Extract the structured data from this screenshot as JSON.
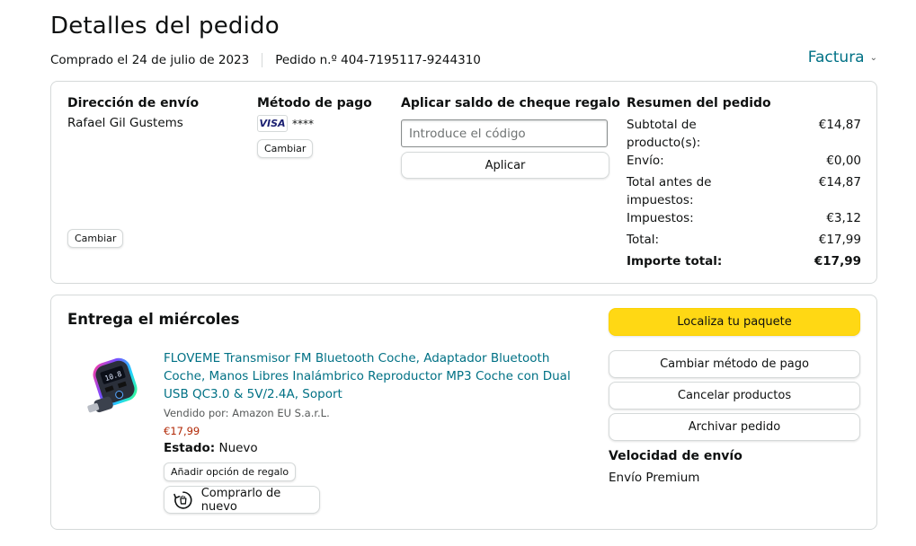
{
  "page": {
    "title": "Detalles del pedido",
    "purchase_date": "Comprado el 24 de julio de 2023",
    "order_number": "Pedido n.º 404-7195117-9244310",
    "invoice_label": "Factura"
  },
  "shipping": {
    "heading": "Dirección de envío",
    "name": "Rafael Gil Gustems",
    "change_label": "Cambiar"
  },
  "payment": {
    "heading": "Método de pago",
    "card_brand": "VISA",
    "card_mask": "****",
    "change_label": "Cambiar"
  },
  "gift_card": {
    "heading": "Aplicar saldo de cheque regalo",
    "placeholder": "Introduce el código",
    "apply_label": "Aplicar"
  },
  "summary": {
    "heading": "Resumen del pedido",
    "rows": [
      {
        "label": "Subtotal de producto(s):",
        "value": "€14,87"
      },
      {
        "label": "Envío:",
        "value": "€0,00"
      },
      {
        "label": "Total antes de impuestos:",
        "value": "€14,87"
      },
      {
        "label": "Impuestos:",
        "value": "€3,12"
      },
      {
        "label": "Total:",
        "value": "€17,99"
      }
    ],
    "grand_total_label": "Importe total:",
    "grand_total_value": "€17,99"
  },
  "delivery": {
    "heading": "Entrega el miércoles",
    "product": {
      "title": "FLOVEME Transmisor FM Bluetooth Coche, Adaptador Bluetooth Coche, Manos Libres Inalámbrico Reproductor MP3 Coche con Dual USB QC3.0 & 5V/2.4A, Soport",
      "seller": "Vendido por: Amazon EU S.a.r.L.",
      "price": "€17,99",
      "status_label": "Estado:",
      "status_value": "Nuevo",
      "gift_label": "Añadir opción de regalo",
      "rebuy_label": "Comprarlo de nuevo"
    },
    "actions": {
      "track": "Localiza tu paquete",
      "change_payment": "Cambiar método de pago",
      "cancel": "Cancelar productos",
      "archive": "Archivar pedido"
    },
    "speed_heading": "Velocidad de envío",
    "speed_value": "Envío Premium"
  },
  "colors": {
    "link": "#007185",
    "price": "#b12704",
    "primary_button": "#ffd814",
    "border": "#d5d9d9"
  }
}
